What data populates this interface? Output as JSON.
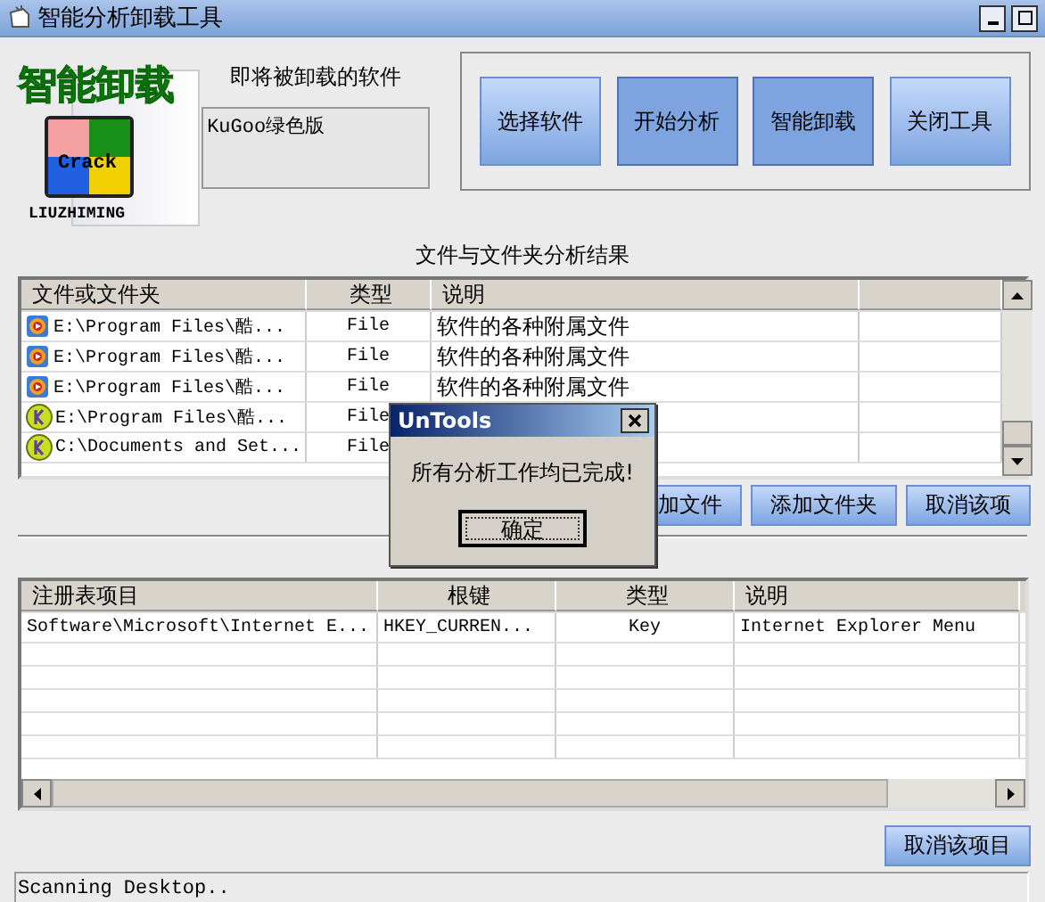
{
  "window": {
    "title": "智能分析卸载工具"
  },
  "logo": {
    "title": "智能卸载",
    "badge": "Crack",
    "caption": "LIUZHIMING"
  },
  "target": {
    "label": "即将被卸载的软件",
    "value": "KuGoo绿色版"
  },
  "actions": [
    {
      "label": "选择软件",
      "pressed": false
    },
    {
      "label": "开始分析",
      "pressed": true
    },
    {
      "label": "智能卸载",
      "pressed": true
    },
    {
      "label": "关闭工具",
      "pressed": false
    }
  ],
  "files": {
    "title": "文件与文件夹分析结果",
    "columns": [
      "文件或文件夹",
      "类型",
      "说明"
    ],
    "rows": [
      {
        "kind": "player",
        "path": "E:\\Program Files\\酷...",
        "type": "File",
        "desc": "软件的各种附属文件"
      },
      {
        "kind": "player",
        "path": "E:\\Program Files\\酷...",
        "type": "File",
        "desc": "软件的各种附属文件"
      },
      {
        "kind": "player",
        "path": "E:\\Program Files\\酷...",
        "type": "File",
        "desc": "软件的各种附属文件"
      },
      {
        "kind": "badge",
        "path": "E:\\Program Files\\酷...",
        "type": "File"
      },
      {
        "kind": "badge",
        "path": "C:\\Documents and Set...",
        "type": "File"
      }
    ],
    "buttons": [
      "加文件",
      "添加文件夹",
      "取消该项"
    ]
  },
  "registry": {
    "columns": [
      "注册表项目",
      "根键",
      "类型",
      "说明"
    ],
    "rows": [
      {
        "key": "Software\\Microsoft\\Internet E...",
        "root": "HKEY_CURREN...",
        "type": "Key",
        "desc": "Internet Explorer Menu"
      }
    ],
    "button": "取消该项目"
  },
  "status_bar": {
    "text": "Scanning Desktop.."
  },
  "dialog": {
    "title": "UnTools",
    "message": "所有分析工作均已完成!",
    "button": "确定"
  }
}
